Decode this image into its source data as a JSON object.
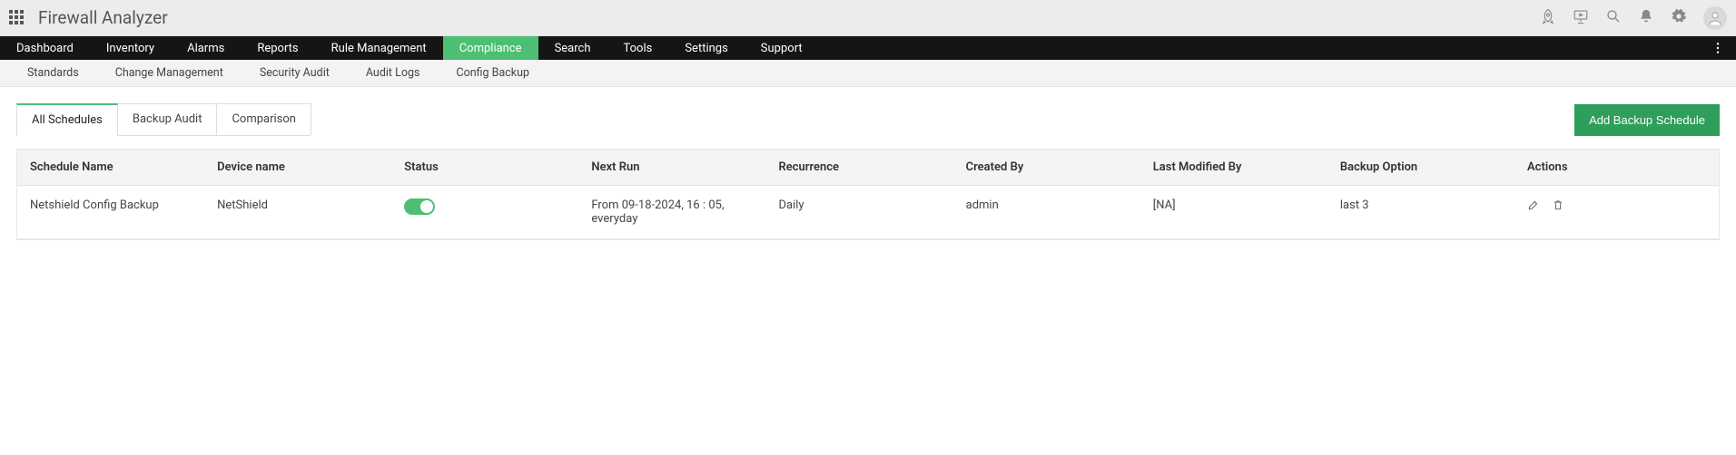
{
  "app_title": "Firewall Analyzer",
  "main_nav": [
    {
      "label": "Dashboard"
    },
    {
      "label": "Inventory"
    },
    {
      "label": "Alarms"
    },
    {
      "label": "Reports"
    },
    {
      "label": "Rule Management"
    },
    {
      "label": "Compliance",
      "active": true
    },
    {
      "label": "Search"
    },
    {
      "label": "Tools"
    },
    {
      "label": "Settings"
    },
    {
      "label": "Support"
    }
  ],
  "sub_nav": [
    {
      "label": "Standards"
    },
    {
      "label": "Change Management"
    },
    {
      "label": "Security Audit"
    },
    {
      "label": "Audit Logs"
    },
    {
      "label": "Config Backup",
      "active": true
    }
  ],
  "tabs": [
    {
      "label": "All Schedules",
      "active": true
    },
    {
      "label": "Backup Audit"
    },
    {
      "label": "Comparison"
    }
  ],
  "add_button": "Add Backup Schedule",
  "table": {
    "headers": {
      "schedule_name": "Schedule Name",
      "device_name": "Device name",
      "status": "Status",
      "next_run": "Next Run",
      "recurrence": "Recurrence",
      "created_by": "Created By",
      "last_modified_by": "Last Modified By",
      "backup_option": "Backup Option",
      "actions": "Actions"
    },
    "rows": [
      {
        "schedule_name": "Netshield Config Backup",
        "device_name": "NetShield",
        "status_on": true,
        "next_run": "From 09-18-2024, 16 : 05, everyday",
        "recurrence": "Daily",
        "created_by": "admin",
        "last_modified_by": "[NA]",
        "backup_option": "last 3"
      }
    ]
  }
}
